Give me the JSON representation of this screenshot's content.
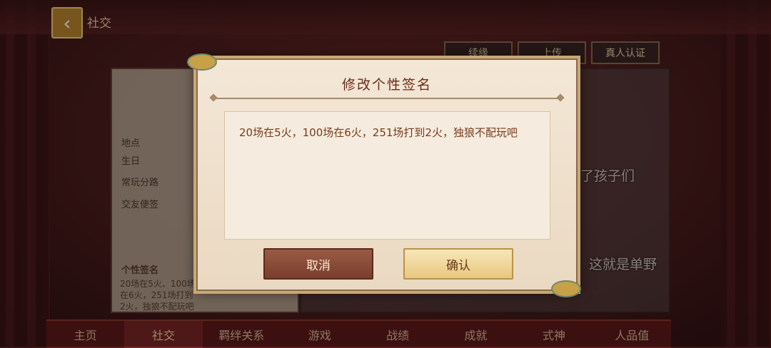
{
  "page": {
    "back_icon": "chevron-left-icon",
    "title": "社交"
  },
  "header_buttons": [
    "续缘",
    "上传",
    "真人认证"
  ],
  "profile": {
    "fields": [
      "地点",
      "生日",
      "常玩分路",
      "交友便签"
    ],
    "signature_label": "个性签名",
    "signature_preview": "20场在5火、100场在6火，251场打到2火，独狼不配玩吧"
  },
  "background_overlays": [
    "别看了孩子们",
    "这就是单野"
  ],
  "dialog": {
    "title": "修改个性签名",
    "input_value": "20场在5火，100场在6火，251场打到2火，独狼不配玩吧",
    "cancel_label": "取消",
    "confirm_label": "确认"
  },
  "bottom_nav": [
    {
      "label": "主页",
      "active": false
    },
    {
      "label": "社交",
      "active": true
    },
    {
      "label": "羁绊关系",
      "active": false
    },
    {
      "label": "游戏",
      "active": false
    },
    {
      "label": "战绩",
      "active": false
    },
    {
      "label": "成就",
      "active": false
    },
    {
      "label": "式神",
      "active": false
    },
    {
      "label": "人品值",
      "active": false
    }
  ],
  "colors": {
    "accent": "#b8832b",
    "dialog_bg": "#f3e7d6",
    "title_text": "#6a2a1a"
  }
}
